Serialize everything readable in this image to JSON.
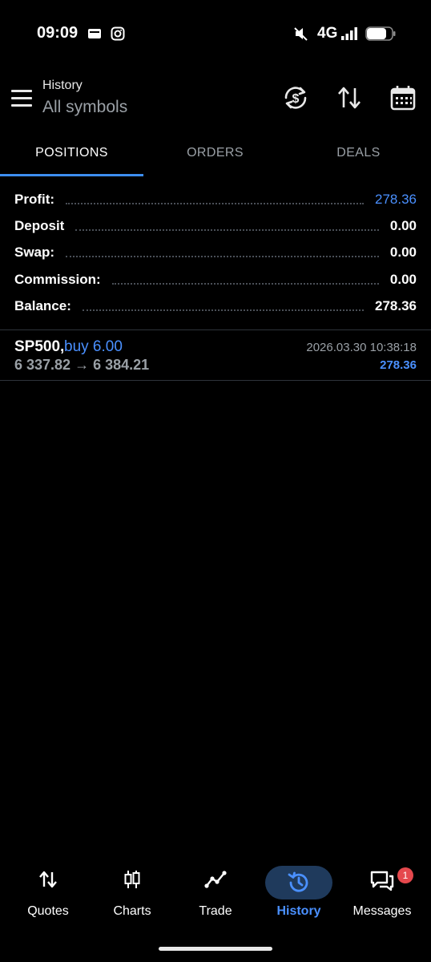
{
  "status_bar": {
    "time": "09:09",
    "network": "4G"
  },
  "header": {
    "subtitle": "History",
    "title": "All symbols"
  },
  "tabs": [
    {
      "label": "POSITIONS",
      "active": true
    },
    {
      "label": "ORDERS",
      "active": false
    },
    {
      "label": "DEALS",
      "active": false
    }
  ],
  "summary": {
    "profit_label": "Profit:",
    "profit_value": "278.36",
    "deposit_label": "Deposit",
    "deposit_value": "0.00",
    "swap_label": "Swap:",
    "swap_value": "0.00",
    "commission_label": "Commission:",
    "commission_value": "0.00",
    "balance_label": "Balance:",
    "balance_value": "278.36"
  },
  "positions": [
    {
      "symbol": "SP500,",
      "action": "buy 6.00",
      "prices": "6 337.82 → 6 384.21",
      "time": "2026.03.30 10:38:18",
      "profit": "278.36"
    }
  ],
  "bottom_nav": {
    "items": [
      {
        "label": "Quotes",
        "icon": "quotes-icon",
        "active": false
      },
      {
        "label": "Charts",
        "icon": "charts-icon",
        "active": false
      },
      {
        "label": "Trade",
        "icon": "trade-icon",
        "active": false
      },
      {
        "label": "History",
        "icon": "history-icon",
        "active": true
      },
      {
        "label": "Messages",
        "icon": "messages-icon",
        "active": false,
        "badge": "1"
      }
    ]
  },
  "colors": {
    "accent": "#4a90ff",
    "tab_indicator": "#3d8ef0",
    "background": "#000000",
    "muted": "#9aa0a6",
    "badge": "#e5484d"
  }
}
